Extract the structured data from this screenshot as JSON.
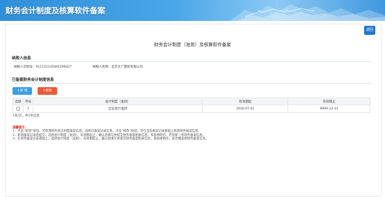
{
  "header": {
    "title": "财务会计制度及核算软件备案"
  },
  "toolbar": {
    "return_label": "返回"
  },
  "page": {
    "title": "财务会计制度（准则）及核算软件备案"
  },
  "taxpayer": {
    "section_title": "纳税人信息",
    "tax_id_label": "纳税人识别号：",
    "tax_id_value": "911101145844299427",
    "name_label": "纳税人名称：",
    "name_value": "北京大广建筑有限公司"
  },
  "filed": {
    "section_title": "已备案财务会计制度信息",
    "add_label": "十新 增",
    "edit_label": "修改",
    "table": {
      "headers": [
        "选择",
        "序号",
        "会计制度（准则）",
        "有效期起",
        "有效期止"
      ],
      "rows": [
        [
          "",
          "1",
          "企业会计准则",
          "2016-07-01",
          "9999-12-31"
        ]
      ]
    },
    "record_count": "1条/页，共1条信息"
  },
  "notes": {
    "title": "温馨提示：",
    "items": [
      "1、点击“新增”按钮，可新增财务会计制度备案信息；选择已备案记录信息，点击“修改”按钮，可在当前备案记录基础上修改财务备案信息。",
      "2、新增备案记录后提交，选择会计制度（准则），有效期起止，确认后填写并提交财务备案相关信息，系统将明示，若有新一条财务备案信息。",
      "3、在修改备案记录基础上，选择会计制度（准则），有效期起止，确认后填写并提交财务备案相关信息，系统将明示，是否覆盖原财务备案信息。"
    ]
  },
  "colors": {
    "header_blue": "#2f8fd8",
    "accent_blue": "#1f78d1",
    "edit_orange": "#ec5a38",
    "notice_red": "#e03020"
  }
}
